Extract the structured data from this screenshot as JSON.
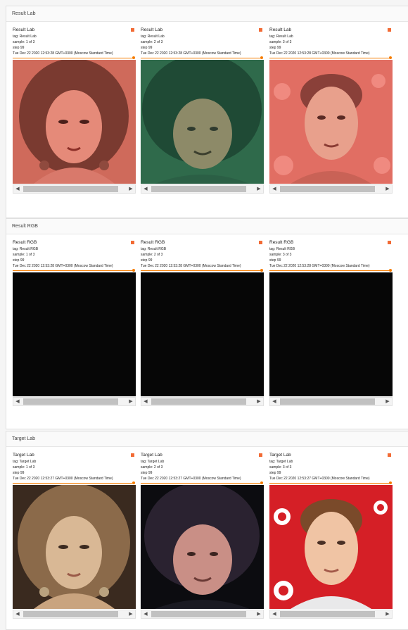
{
  "sections": [
    {
      "title": "Result Lab",
      "cards": [
        {
          "title": "Result Lab",
          "tag": "tag: Result Lab",
          "sample": "sample: 1 of 3",
          "step": "step 99",
          "time": "Tue Dec 22 2020 12:53:28 GMT+0300 (Moscow Standard Time)",
          "image": "woman-face-portrait-salmon-tint"
        },
        {
          "title": "Result Lab",
          "tag": "tag: Result Lab",
          "sample": "sample: 2 of 3",
          "step": "step 99",
          "time": "Tue Dec 22 2020 12:53:28 GMT+0300 (Moscow Standard Time)",
          "image": "man-curly-hair-portrait-green-tint"
        },
        {
          "title": "Result Lab",
          "tag": "tag: Result Lab",
          "sample": "sample: 3 of 3",
          "step": "step 99",
          "time": "Tue Dec 22 2020 12:53:28 GMT+0300 (Moscow Standard Time)",
          "image": "young-man-portrait-salmon-tint"
        }
      ]
    },
    {
      "title": "Result RGB",
      "cards": [
        {
          "title": "Result RGB",
          "tag": "tag: Result RGB",
          "sample": "sample: 1 of 3",
          "step": "step 99",
          "time": "Tue Dec 22 2020 12:53:28 GMT+0300 (Moscow Standard Time)",
          "image": "black-image"
        },
        {
          "title": "Result RGB",
          "tag": "tag: Result RGB",
          "sample": "sample: 2 of 3",
          "step": "step 99",
          "time": "Tue Dec 22 2020 12:53:28 GMT+0300 (Moscow Standard Time)",
          "image": "black-image"
        },
        {
          "title": "Result RGB",
          "tag": "tag: Result RGB",
          "sample": "sample: 3 of 3",
          "step": "step 99",
          "time": "Tue Dec 22 2020 12:53:28 GMT+0300 (Moscow Standard Time)",
          "image": "black-image"
        }
      ]
    },
    {
      "title": "Target Lab",
      "cards": [
        {
          "title": "Target Lab",
          "tag": "tag: Target Lab",
          "sample": "sample: 1 of 3",
          "step": "step 99",
          "time": "Tue Dec 22 2020 12:53:27 GMT+0300 (Moscow Standard Time)",
          "image": "woman-face-portrait-sepia"
        },
        {
          "title": "Target Lab",
          "tag": "tag: Target Lab",
          "sample": "sample: 2 of 3",
          "step": "step 99",
          "time": "Tue Dec 22 2020 12:53:27 GMT+0300 (Moscow Standard Time)",
          "image": "man-curly-hair-portrait-color"
        },
        {
          "title": "Target Lab",
          "tag": "tag: Target Lab",
          "sample": "sample: 3 of 3",
          "step": "step 99",
          "time": "Tue Dec 22 2020 12:53:27 GMT+0300 (Moscow Standard Time)",
          "image": "young-man-portrait-red-background"
        }
      ]
    }
  ],
  "colors": {
    "accent": "#f57c00",
    "flag": "#f26b35",
    "salmon_tint": "#dc6f63",
    "green_tint": "#3f7b5a",
    "black_image": "#060606"
  },
  "icons": {
    "scroll_left": "◀",
    "scroll_right": "▶"
  }
}
